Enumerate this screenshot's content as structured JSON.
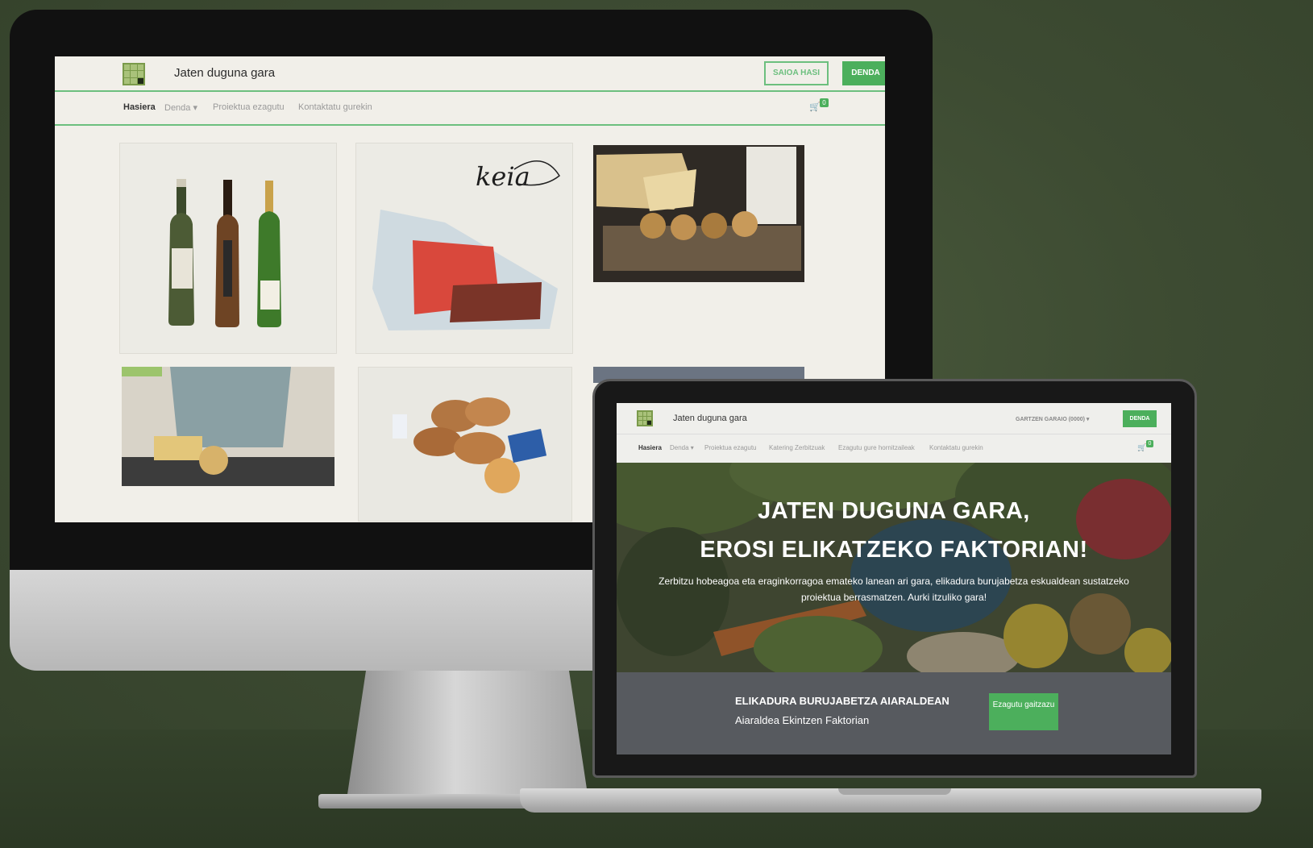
{
  "desktop": {
    "brand": "Jaten duguna gara",
    "login_label": "SAIOA HASI",
    "shop_label": "DENDA",
    "nav": [
      {
        "label": "Hasiera",
        "active": true
      },
      {
        "label": "Denda ▾",
        "active": false
      },
      {
        "label": "Proiektua ezagutu",
        "active": false
      },
      {
        "label": "Kontaktatu gurekin",
        "active": false
      }
    ],
    "cart_count": "0",
    "products": [
      {
        "name": "wine-bottles-image"
      },
      {
        "name": "keia-salmon-image",
        "logo_text": "keia"
      },
      {
        "name": "cheese-and-bread-image"
      },
      {
        "name": "chef-cutting-cheese-image"
      },
      {
        "name": "pastries-image"
      },
      {
        "name": "partial-product-image"
      }
    ]
  },
  "laptop": {
    "brand": "Jaten duguna gara",
    "user_menu": "GARTZEN GARAIO (0000) ▾",
    "shop_label": "DENDA",
    "nav": [
      {
        "label": "Hasiera",
        "active": true
      },
      {
        "label": "Denda ▾",
        "active": false
      },
      {
        "label": "Proiektua ezagutu",
        "active": false
      },
      {
        "label": "Katering Zerbitzuak",
        "active": false
      },
      {
        "label": "Ezagutu gure hornitzaileak",
        "active": false
      },
      {
        "label": "Kontaktatu gurekin",
        "active": false
      }
    ],
    "cart_count": "0",
    "hero": {
      "title_line1": "JATEN DUGUNA GARA,",
      "title_line2": "EROSI ELIKATZEKO FAKTORIAN!",
      "subtitle": "Zerbitzu hobeagoa eta eraginkorragoa emateko lanean ari gara, elikadura burujabetza eskualdean sustatzeko proiektua berrasmatzen. Aurki itzuliko gara!"
    },
    "band": {
      "title": "ELIKADURA BURUJABETZA AIARALDEAN",
      "subtitle": "Aiaraldea Ekintzen Faktorian",
      "button": "Ezagutu gaitzazu"
    }
  },
  "colors": {
    "background": "#3d4b32",
    "accent_green": "#4caf5c",
    "divider_green": "#6cbf7e",
    "band_gray": "#575a5f"
  }
}
